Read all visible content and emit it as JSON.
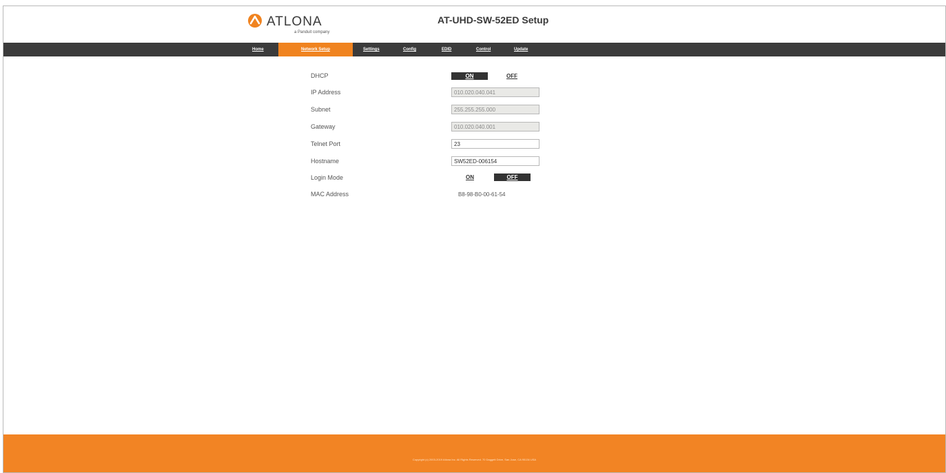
{
  "brand": {
    "name": "ATLONA",
    "tagline": "a Panduit company",
    "accent_color": "#f0831f",
    "nav_color": "#3b3b3b"
  },
  "header": {
    "title": "AT-UHD-SW-52ED Setup"
  },
  "nav": {
    "items": [
      {
        "label": "Home"
      },
      {
        "label": "Network Setup"
      },
      {
        "label": "Settings"
      },
      {
        "label": "Config"
      },
      {
        "label": "EDID"
      },
      {
        "label": "Control"
      },
      {
        "label": "Update"
      }
    ],
    "active": "Network Setup"
  },
  "form": {
    "dhcp": {
      "label": "DHCP",
      "on_label": "ON",
      "off_label": "OFF",
      "value": "ON"
    },
    "ip_address": {
      "label": "IP Address",
      "value": "010.020.040.041"
    },
    "subnet": {
      "label": "Subnet",
      "value": "255.255.255.000"
    },
    "gateway": {
      "label": "Gateway",
      "value": "010.020.040.001"
    },
    "telnet_port": {
      "label": "Telnet Port",
      "value": "23"
    },
    "hostname": {
      "label": "Hostname",
      "value": "SW52ED-006154"
    },
    "login_mode": {
      "label": "Login Mode",
      "on_label": "ON",
      "off_label": "OFF",
      "value": "OFF"
    },
    "mac_address": {
      "label": "MAC Address",
      "value": "B8-98-B0-00-61-54"
    }
  },
  "footer": {
    "text": "Copyright (c) 2003-2019 Atlona Inc. All Rights Reserved. 70 Daggett Drive, San Jose, CA 95134 USA"
  }
}
